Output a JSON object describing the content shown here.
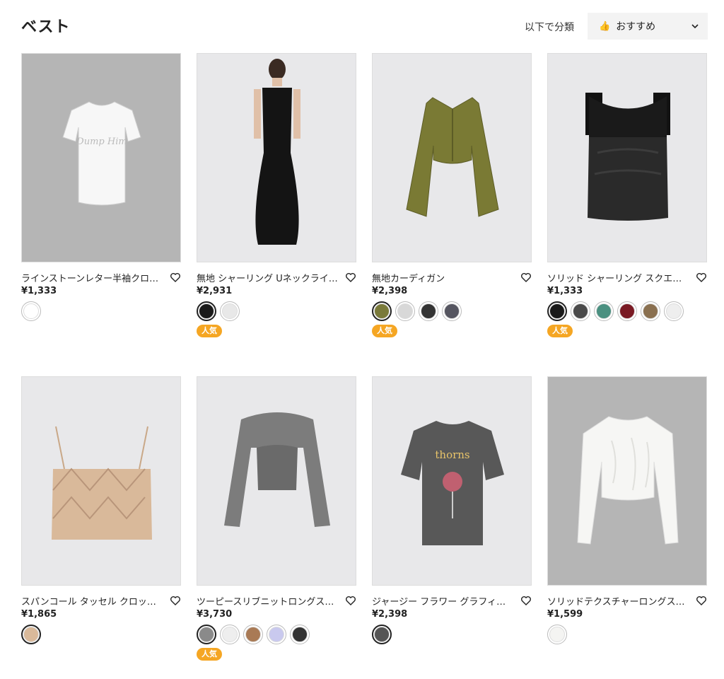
{
  "header": {
    "title": "ベスト",
    "sort_label": "以下で分類",
    "sort_value": "おすすめ"
  },
  "products": [
    {
      "title": "ラインストーンレター半袖クロップドTシャツ",
      "price": "¥1,333",
      "badge": "",
      "bg": "#b5b5b5",
      "icon": "white-tshirt",
      "swatches": [
        {
          "color": "#ffffff",
          "selected": false
        }
      ]
    },
    {
      "title": "無地 シャーリング Uネックライン マキシドレス",
      "price": "¥2,931",
      "badge": "人気",
      "bg": "#e8e8ea",
      "icon": "black-maxi-dress",
      "swatches": [
        {
          "color": "#1a1a1a",
          "selected": true
        },
        {
          "color": "#e8e8e8",
          "selected": false
        }
      ]
    },
    {
      "title": "無地カーディガン",
      "price": "¥2,398",
      "badge": "人気",
      "bg": "#e8e8ea",
      "icon": "olive-cardigan",
      "swatches": [
        {
          "color": "#7a7a3a",
          "selected": true
        },
        {
          "color": "#d8d8d8",
          "selected": false
        },
        {
          "color": "#333333",
          "selected": false
        },
        {
          "color": "#555560",
          "selected": false
        }
      ]
    },
    {
      "title": "ソリッド シャーリング スクエアネック タンクトップ",
      "price": "¥1,333",
      "badge": "人気",
      "bg": "#e8e8ea",
      "icon": "black-tank-top",
      "swatches": [
        {
          "color": "#1a1a1a",
          "selected": true
        },
        {
          "color": "#4a4a4a",
          "selected": false
        },
        {
          "color": "#4a9080",
          "selected": false
        },
        {
          "color": "#7a1a24",
          "selected": false
        },
        {
          "color": "#8a7050",
          "selected": false
        },
        {
          "color": "#eeeeee",
          "selected": false
        }
      ]
    },
    {
      "title": "スパンコール タッセル クロップ キャミソール",
      "price": "¥1,865",
      "badge": "",
      "bg": "#e8e8ea",
      "icon": "sequin-cami",
      "swatches": [
        {
          "color": "#d9b99a",
          "selected": true
        }
      ]
    },
    {
      "title": "ツーピースリブニットロングスリーブトップ",
      "price": "¥3,730",
      "badge": "人気",
      "bg": "#e8e8ea",
      "icon": "grey-knit-set",
      "swatches": [
        {
          "color": "#8a8a8a",
          "selected": true
        },
        {
          "color": "#eeeeee",
          "selected": false
        },
        {
          "color": "#a97a55",
          "selected": false
        },
        {
          "color": "#c9c9ee",
          "selected": false
        },
        {
          "color": "#333333",
          "selected": false
        }
      ]
    },
    {
      "title": "ジャージー フラワー グラフィック Tシャツ",
      "price": "¥2,398",
      "badge": "",
      "bg": "#e8e8ea",
      "icon": "graphic-tshirt",
      "swatches": [
        {
          "color": "#555555",
          "selected": true
        }
      ]
    },
    {
      "title": "ソリッドテクスチャーロングスリーブトップ",
      "price": "¥1,599",
      "badge": "",
      "bg": "#b5b5b5",
      "icon": "white-longsleeve",
      "swatches": [
        {
          "color": "#f4f4f2",
          "selected": false
        }
      ]
    }
  ]
}
